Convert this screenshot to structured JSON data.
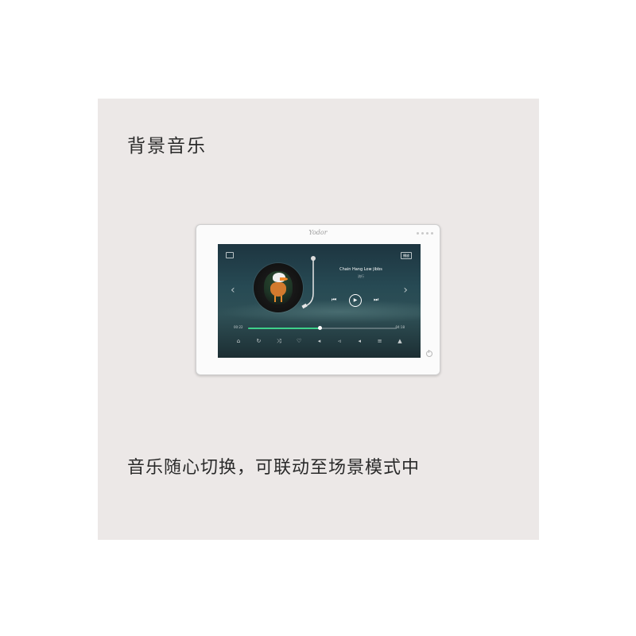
{
  "heading": "背景音乐",
  "caption": "音乐随心切换，可联动至场景模式中",
  "device": {
    "brand": "Yodor",
    "player": {
      "song_title": "Chain Hang Low jibbs",
      "song_subtitle": "流行",
      "tag": "播放",
      "time_elapsed": "00:22",
      "time_total": "04:18",
      "progress": 0.48,
      "accent_color": "#3ed08a"
    }
  },
  "icons": {
    "bottom_bar": [
      "home-icon",
      "repeat-icon",
      "shuffle-icon",
      "heart-icon",
      "volume-down-icon",
      "volume-icon",
      "volume-up-icon",
      "equalizer-icon",
      "playlist-icon"
    ]
  }
}
